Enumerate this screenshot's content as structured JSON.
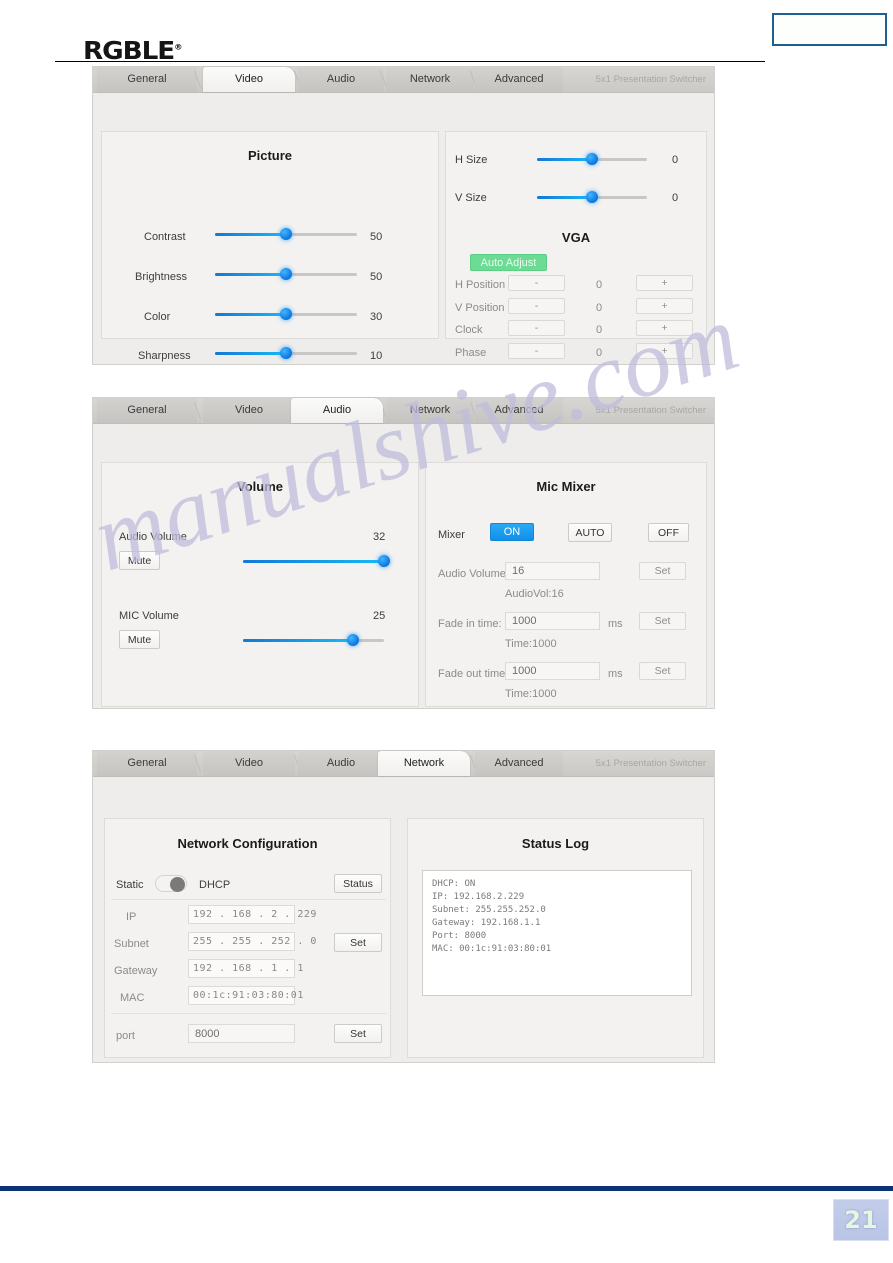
{
  "page": {
    "logo_text": "RGBLE",
    "logo_mark": "®",
    "page_number": "21",
    "watermark": "manualshive.com"
  },
  "tabs": [
    "General",
    "Video",
    "Audio",
    "Network",
    "Advanced"
  ],
  "brand_label": "5x1 Presentation Switcher",
  "panels": {
    "video": {
      "active_tab": "Video",
      "picture": {
        "title": "Picture",
        "sliders": [
          {
            "label": "Contrast",
            "value": "50",
            "percent": 50
          },
          {
            "label": "Brightness",
            "value": "50",
            "percent": 50
          },
          {
            "label": "Color",
            "value": "30",
            "percent": 50
          },
          {
            "label": "Sharpness",
            "value": "10",
            "percent": 50
          }
        ]
      },
      "size": {
        "sliders": [
          {
            "label": "H Size",
            "value": "0",
            "percent": 50
          },
          {
            "label": "V Size",
            "value": "0",
            "percent": 50
          }
        ]
      },
      "vga": {
        "title": "VGA",
        "auto_adjust_label": "Auto Adjust",
        "minus_label": "-",
        "plus_label": "+",
        "rows": [
          {
            "label": "H Position",
            "value": "0"
          },
          {
            "label": "V Position",
            "value": "0"
          },
          {
            "label": "Clock",
            "value": "0"
          },
          {
            "label": "Phase",
            "value": "0"
          }
        ]
      }
    },
    "audio": {
      "active_tab": "Audio",
      "volume": {
        "title": "Volume",
        "rows": [
          {
            "label": "Audio Volume",
            "value": "32",
            "mute_label": "Mute",
            "percent": 100
          },
          {
            "label": "MIC Volume",
            "value": "25",
            "mute_label": "Mute",
            "percent": 78
          }
        ]
      },
      "mic_mixer": {
        "title": "Mic Mixer",
        "mixer_label": "Mixer",
        "on_label": "ON",
        "auto_label": "AUTO",
        "off_label": "OFF",
        "set_label": "Set",
        "ms_label": "ms",
        "audio_volume_label": "Audio Volume:",
        "audio_volume_value": "16",
        "audio_volume_status": "AudioVol:16",
        "fade_in_label": "Fade in time:",
        "fade_in_value": "1000",
        "fade_in_status": "Time:1000",
        "fade_out_label": "Fade out time:",
        "fade_out_value": "1000",
        "fade_out_status": "Time:1000"
      }
    },
    "network": {
      "active_tab": "Network",
      "config": {
        "title": "Network Configuration",
        "static_label": "Static",
        "dhcp_label": "DHCP",
        "status_button": "Status",
        "set_button": "Set",
        "port_set_button": "Set",
        "rows": [
          {
            "label": "IP",
            "octets": [
              "192",
              "168",
              "2",
              "229"
            ]
          },
          {
            "label": "Subnet",
            "octets": [
              "255",
              "255",
              "252",
              "0"
            ]
          },
          {
            "label": "Gateway",
            "octets": [
              "192",
              "168",
              "1",
              "1"
            ]
          }
        ],
        "mac_label": "MAC",
        "mac_value": "00:1c:91:03:80:01",
        "port_label": "port",
        "port_value": "8000"
      },
      "status_log": {
        "title": "Status Log",
        "text": "DHCP: ON\nIP: 192.168.2.229\nSubnet: 255.255.252.0\nGateway: 192.168.1.1\nPort: 8000\nMAC: 00:1c:91:03:80:01"
      }
    }
  }
}
